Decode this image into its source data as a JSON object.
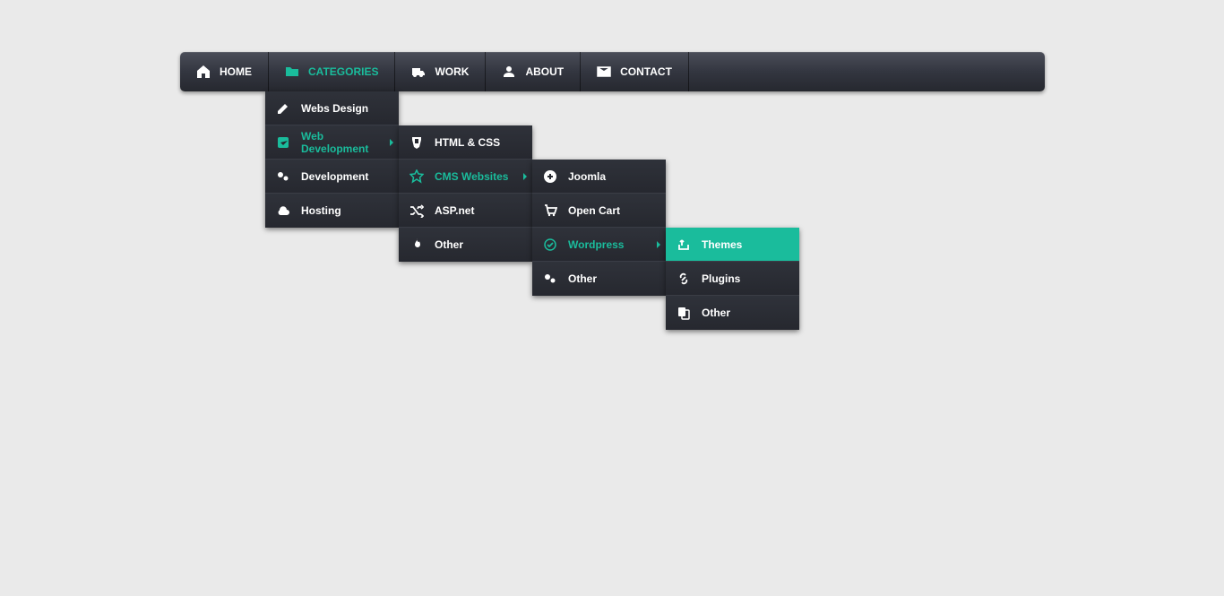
{
  "nav": {
    "items": [
      {
        "label": "HOME"
      },
      {
        "label": "CATEGORIES"
      },
      {
        "label": "WORK"
      },
      {
        "label": "ABOUT"
      },
      {
        "label": "CONTACT"
      }
    ]
  },
  "sub1": {
    "items": [
      {
        "label": "Webs Design"
      },
      {
        "label": "Web Development"
      },
      {
        "label": "Development"
      },
      {
        "label": "Hosting"
      }
    ]
  },
  "sub2": {
    "items": [
      {
        "label": "HTML & CSS"
      },
      {
        "label": "CMS Websites"
      },
      {
        "label": "ASP.net"
      },
      {
        "label": "Other"
      }
    ]
  },
  "sub3": {
    "items": [
      {
        "label": "Joomla"
      },
      {
        "label": "Open Cart"
      },
      {
        "label": "Wordpress"
      },
      {
        "label": "Other"
      }
    ]
  },
  "sub4": {
    "items": [
      {
        "label": "Themes"
      },
      {
        "label": "Plugins"
      },
      {
        "label": "Other"
      }
    ]
  },
  "colors": {
    "accent": "#1abc9c"
  }
}
